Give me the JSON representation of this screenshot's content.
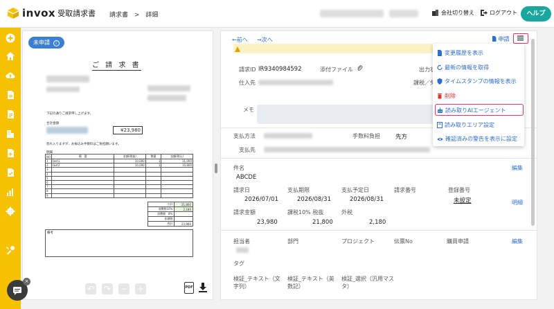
{
  "app": {
    "brand": "invox",
    "product": "受取請求書",
    "accent": "#f6c100",
    "teal": "#1aa7a0",
    "link": "#2e6fcc"
  },
  "breadcrumb": {
    "root": "請求書",
    "sep": ">",
    "current": "詳細"
  },
  "header": {
    "switch_company": "会社切り替え",
    "logout": "ログアウト",
    "help": "ヘルプ"
  },
  "left_nav": {
    "icons": [
      "plus-icon",
      "home-icon",
      "cloud-upload-icon",
      "document-icon",
      "document-list-icon",
      "building-icon",
      "document-add-icon",
      "document-check-icon",
      "chart-icon",
      "gear-icon",
      "tools-icon"
    ]
  },
  "doc_panel": {
    "status": "未申請",
    "status_info_icon": "info-icon",
    "invoice": {
      "title": "ご 請 求 書",
      "greeting": "下記の通りご請求申し上げます。",
      "amount_label": "合計金額",
      "total": "¥23,980",
      "payment_note": "恐れ入りますが、お振込み手数料はご負担願います。",
      "detail_label": "明細",
      "table_header": [
        "NO",
        "摘　要",
        "金額(税抜)",
        "数量",
        "金額(税込)"
      ],
      "rows": [
        [
          "1",
          "test1",
          "10,000",
          "1",
          "11,000"
        ],
        [
          "2",
          "test2",
          "10,000",
          "1",
          "10,800"
        ],
        [
          "3",
          "",
          "",
          "",
          ""
        ],
        [
          "4",
          "",
          "",
          "",
          ""
        ],
        [
          "5",
          "",
          "",
          "",
          ""
        ],
        [
          "6",
          "",
          "",
          "",
          ""
        ],
        [
          "7",
          "",
          "",
          "",
          ""
        ],
        [
          "8",
          "",
          "",
          "",
          ""
        ],
        [
          "9",
          "",
          "",
          "",
          ""
        ]
      ],
      "summary": [
        [
          "小計",
          "21,800"
        ],
        [
          "消費税10%",
          "2,180"
        ],
        [
          "消費税　8%",
          ""
        ],
        [
          "非課税",
          ""
        ],
        [
          "合計",
          "23,980"
        ]
      ],
      "remark_label": "備考"
    },
    "tools": [
      "undo-icon",
      "redo-icon",
      "zoom-out-icon",
      "zoom-in-icon"
    ],
    "pdf_label": "PDF"
  },
  "detail": {
    "prev": "←前へ",
    "next": "→次へ",
    "request_label": "申請",
    "fields": {
      "invoice_id_label": "請求ID",
      "invoice_id": "IR9340984592",
      "attachment_label": "添付ファイル",
      "output_label": "出力状",
      "vendor_label": "仕入先",
      "tax_label": "課税／免",
      "memo_label": "メモ",
      "pay_method_label": "支払方法",
      "fee_label": "手数料負担",
      "fee_value": "先方",
      "payee_label": "支払先",
      "subject_label": "件名",
      "subject": "ABCDE",
      "edit": "編集",
      "invoice_date_label": "請求日",
      "invoice_date": "2026/07/01",
      "due_date_label": "支払期限",
      "due_date": "2026/08/31",
      "plan_date_label": "支払予定日",
      "plan_date": "2026/08/31",
      "invoice_no_label": "請求番号",
      "reg_no_label": "登録番号",
      "reg_no": "未設定",
      "breakdown": "明細",
      "amount_label": "請求金額",
      "amount": "23,980",
      "tax10_label": "課税10% 税抜",
      "tax10": "21,800",
      "ext_tax_label": "外税",
      "ext_tax": "2,180",
      "person_label": "担当者",
      "dept_label": "部門",
      "project_label": "プロジェクト",
      "slip_label": "伝票No",
      "purchase_label": "購買申請",
      "tag_label": "タグ",
      "custom1_label": "検証_テキスト（文字列）",
      "custom2_label": "検証_テキスト（英数記）",
      "custom3_label": "検証_選択（汎用マスタ）"
    }
  },
  "menu": {
    "items": [
      {
        "label": "変更履歴を表示",
        "icon": "document-icon"
      },
      {
        "label": "最新の情報を取得",
        "icon": "refresh-icon"
      },
      {
        "label": "タイムスタンプの情報を表示",
        "icon": "shield-icon"
      },
      {
        "label": "削除",
        "icon": "trash-icon"
      },
      {
        "label": "読み取りAIエージェント",
        "icon": "robot-icon"
      },
      {
        "label": "読み取りエリア設定",
        "icon": "frame-icon"
      },
      {
        "label": "確認済みの警告を表示に設定",
        "icon": "eye-icon"
      }
    ]
  }
}
